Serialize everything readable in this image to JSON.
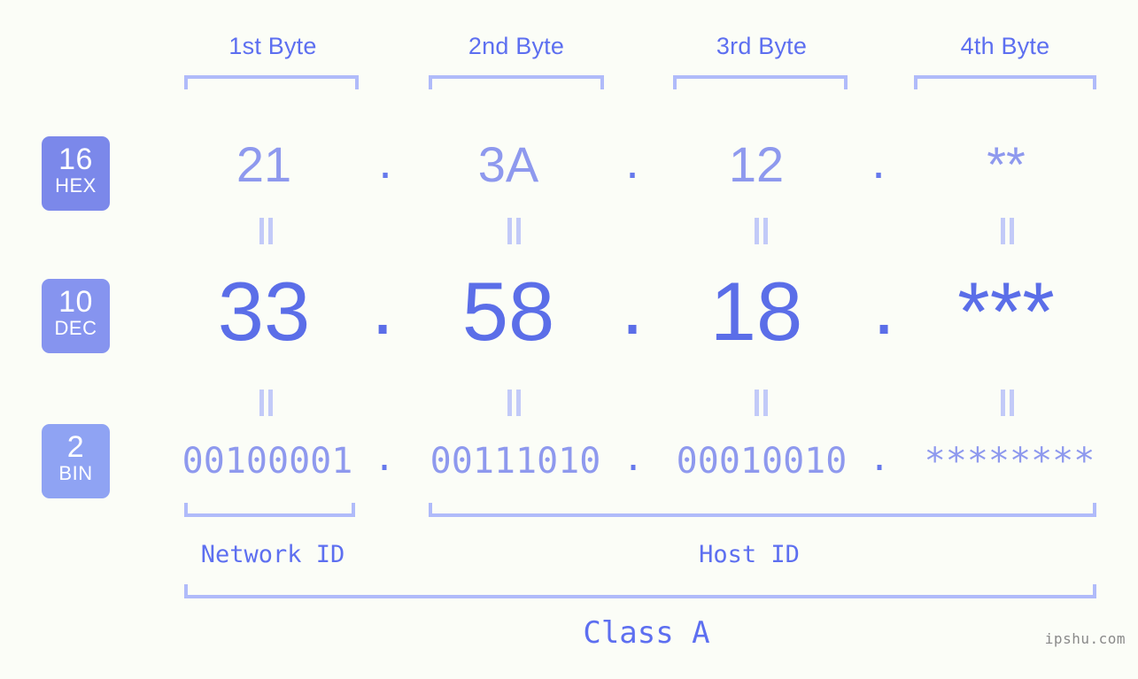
{
  "meta": {
    "background_color": "#fbfdf7",
    "accent_strong": "#5b6ee8",
    "accent_mid": "#8e99ee",
    "accent_light": "#b0bbfa",
    "watermark": "ipshu.com"
  },
  "byte_headers": [
    {
      "label": "1st Byte"
    },
    {
      "label": "2nd Byte"
    },
    {
      "label": "3rd Byte"
    },
    {
      "label": "4th Byte"
    }
  ],
  "bases": [
    {
      "radix": "16",
      "name": "HEX",
      "color": "#7b88ea"
    },
    {
      "radix": "10",
      "name": "DEC",
      "color": "#8694ef"
    },
    {
      "radix": "2",
      "name": "BIN",
      "color": "#8fa3f3"
    }
  ],
  "separator": ".",
  "equals_mark": "||",
  "rows": {
    "hex": {
      "values": [
        "21",
        "3A",
        "12",
        "**"
      ]
    },
    "dec": {
      "values": [
        "33",
        "58",
        "18",
        "***"
      ]
    },
    "bin": {
      "values": [
        "00100001",
        "00111010",
        "00010010",
        "********"
      ]
    }
  },
  "sections": {
    "network_id": "Network ID",
    "host_id": "Host ID",
    "class": "Class A"
  }
}
